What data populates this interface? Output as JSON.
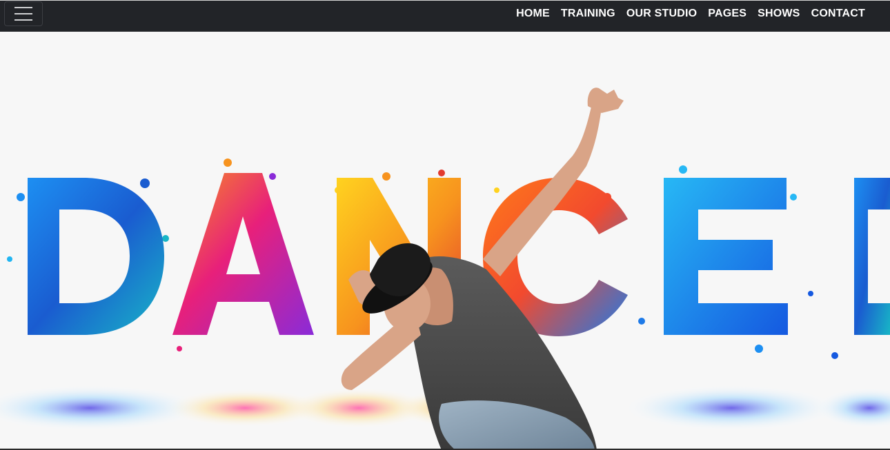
{
  "navbar": {
    "toggle_icon": "hamburger-menu-icon",
    "links": [
      {
        "label": "HOME"
      },
      {
        "label": "TRAINING"
      },
      {
        "label": "OUR STUDIO"
      },
      {
        "label": "PAGES"
      },
      {
        "label": "SHOWS"
      },
      {
        "label": "CONTACT"
      }
    ],
    "background": "#222428",
    "text_color": "#ffffff"
  },
  "hero": {
    "banner_word": "DANCE",
    "image": "dancer-hero-image",
    "colors": {
      "blue": "#1a6fe0",
      "cyan": "#21b5f2",
      "magenta": "#e8207a",
      "orange": "#f7931e",
      "purple": "#6b2fb8",
      "yellow": "#ffd21f"
    }
  }
}
